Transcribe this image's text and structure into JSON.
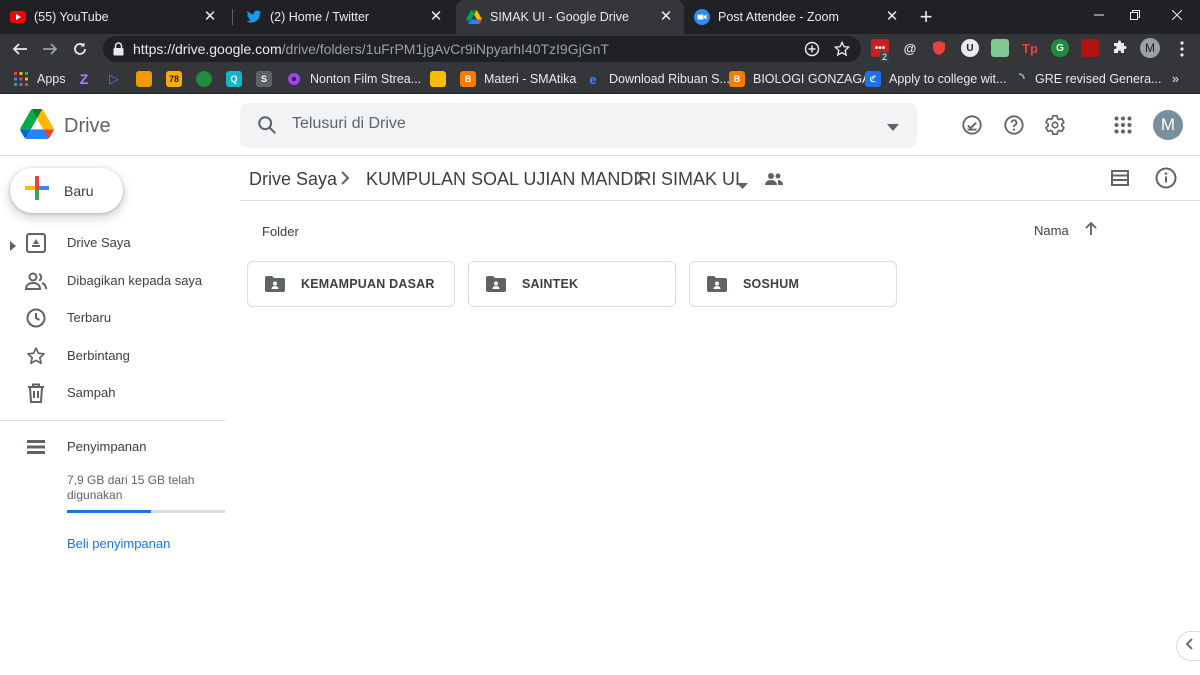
{
  "browser": {
    "tabs": [
      {
        "title": "(55) YouTube",
        "icon": "youtube-icon"
      },
      {
        "title": "(2) Home / Twitter",
        "icon": "twitter-icon"
      },
      {
        "title": "SIMAK UI - Google Drive",
        "icon": "google-drive-icon"
      },
      {
        "title": "Post Attendee - Zoom",
        "icon": "zoom-icon"
      }
    ],
    "url_host": "https://drive.google.com",
    "url_path": "/drive/folders/1uFrPM1jgAvCr9iNpyarhI40TzI9GjGnT",
    "extension_badge": "2",
    "profile_initial": "M",
    "bookmarks": [
      {
        "label": "Apps"
      },
      {
        "label": ""
      },
      {
        "label": ""
      },
      {
        "label": ""
      },
      {
        "label": "78"
      },
      {
        "label": ""
      },
      {
        "label": "Q"
      },
      {
        "label": ""
      },
      {
        "label": "Nonton Film Strea..."
      },
      {
        "label": ""
      },
      {
        "label": "Materi - SMAtika"
      },
      {
        "label": "Download Ribuan S..."
      },
      {
        "label": "BIOLOGI GONZAGA"
      },
      {
        "label": "Apply to college wit..."
      },
      {
        "label": "GRE revised Genera..."
      }
    ]
  },
  "drive": {
    "logo_text": "Drive",
    "search_placeholder": "Telusuri di Drive",
    "avatar_initial": "M",
    "new_button": "Baru",
    "nav": [
      {
        "label": "Drive Saya",
        "icon": "my-drive-icon"
      },
      {
        "label": "Dibagikan kepada saya",
        "icon": "shared-icon"
      },
      {
        "label": "Terbaru",
        "icon": "clock-icon"
      },
      {
        "label": "Berbintang",
        "icon": "star-icon"
      },
      {
        "label": "Sampah",
        "icon": "trash-icon"
      }
    ],
    "storage": {
      "label": "Penyimpanan",
      "usage_text": "7,9 GB dari 15 GB telah digunakan",
      "used_fraction": 0.53,
      "buy_label": "Beli penyimpanan"
    },
    "breadcrumb": [
      "Drive Saya",
      "KUMPULAN SOAL UJIAN MANDIRI",
      "SIMAK UI"
    ],
    "section_label": "Folder",
    "sort_label": "Nama",
    "folders": [
      "KEMAMPUAN DASAR",
      "SAINTEK",
      "SOSHUM"
    ]
  },
  "colors": {
    "accent": "#1a73e8",
    "chrome_dark": "#202124",
    "chrome_toolbar": "#35363a"
  }
}
